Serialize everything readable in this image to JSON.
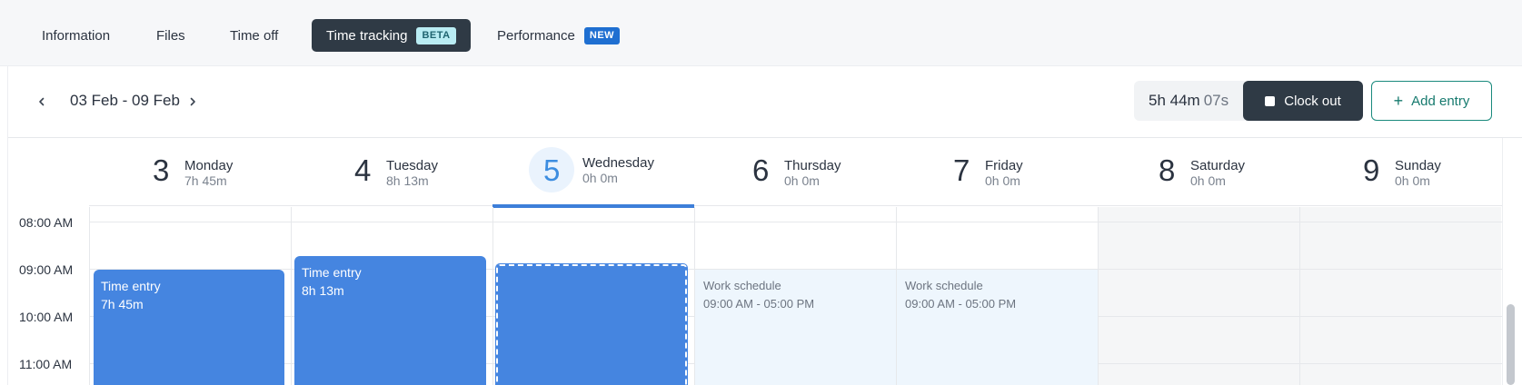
{
  "tabs": [
    {
      "label": "Information"
    },
    {
      "label": "Files"
    },
    {
      "label": "Time off"
    },
    {
      "label": "Time tracking",
      "badge": "BETA"
    },
    {
      "label": "Performance",
      "badge": "NEW"
    }
  ],
  "toolbar": {
    "prev_icon": "chevron-left-icon",
    "next_icon": "chevron-right-icon",
    "date_range": "03 Feb - 09 Feb",
    "timer_hm": "5h 44m",
    "timer_sec": "07s",
    "clock_out_label": "Clock out",
    "add_entry_label": "Add entry"
  },
  "days": [
    {
      "num": "3",
      "name": "Monday",
      "total": "7h 45m"
    },
    {
      "num": "4",
      "name": "Tuesday",
      "total": "8h 13m"
    },
    {
      "num": "5",
      "name": "Wednesday",
      "total": "0h 0m"
    },
    {
      "num": "6",
      "name": "Thursday",
      "total": "0h 0m"
    },
    {
      "num": "7",
      "name": "Friday",
      "total": "0h 0m"
    },
    {
      "num": "8",
      "name": "Saturday",
      "total": "0h 0m"
    },
    {
      "num": "9",
      "name": "Sunday",
      "total": "0h 0m"
    }
  ],
  "time_labels": [
    "08:00 AM",
    "09:00 AM",
    "10:00 AM",
    "11:00 AM"
  ],
  "entries": [
    {
      "title": "Time entry",
      "duration": "7h 45m"
    },
    {
      "title": "Time entry",
      "duration": "8h 13m"
    }
  ],
  "schedules": [
    {
      "title": "Work schedule",
      "range": "09:00 AM - 05:00 PM"
    },
    {
      "title": "Work schedule",
      "range": "09:00 AM - 05:00 PM"
    }
  ],
  "colors": {
    "accent": "#4585e0",
    "dark_button": "#2f3a45",
    "add_entry_border": "#1a8a7d",
    "today": "#3d8de0",
    "schedule_bg": "#eef6fd"
  }
}
